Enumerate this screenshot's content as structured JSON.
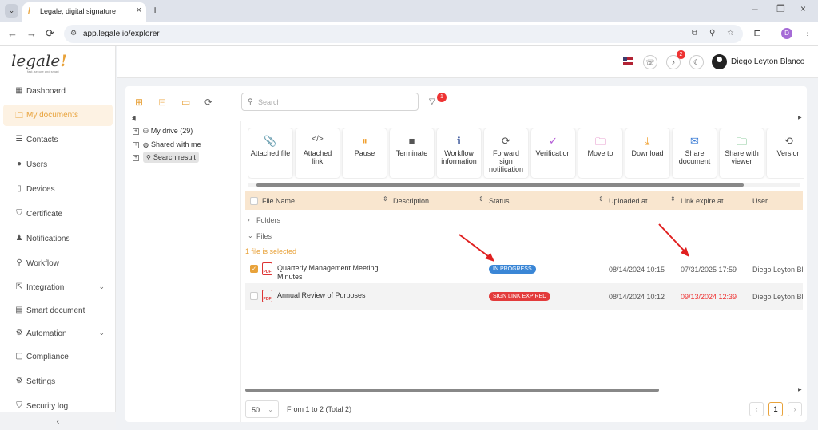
{
  "browser": {
    "tab_title": "Legale, digital signature",
    "url": "app.legale.io/explorer",
    "profile_initial": "D"
  },
  "logo": {
    "text": "legale",
    "mark": "!",
    "tagline": "fast, secure and smart"
  },
  "sidebar": {
    "items": [
      {
        "label": "Dashboard",
        "icon": "dashboard-icon",
        "glyph": "▦"
      },
      {
        "label": "My documents",
        "icon": "folder-icon",
        "glyph": "🗀"
      },
      {
        "label": "Contacts",
        "icon": "contacts-icon",
        "glyph": "☰"
      },
      {
        "label": "Users",
        "icon": "user-icon",
        "glyph": "●"
      },
      {
        "label": "Devices",
        "icon": "device-icon",
        "glyph": "▯"
      },
      {
        "label": "Certificate",
        "icon": "shield-icon",
        "glyph": "⛉"
      },
      {
        "label": "Notifications",
        "icon": "bell-icon",
        "glyph": "♟"
      },
      {
        "label": "Workflow",
        "icon": "workflow-icon",
        "glyph": "⚲"
      },
      {
        "label": "Integration",
        "icon": "integration-icon",
        "glyph": "⇱"
      },
      {
        "label": "Smart document",
        "icon": "smart-document-icon",
        "glyph": "▤"
      },
      {
        "label": "Automation",
        "icon": "automation-icon",
        "glyph": "⚙"
      },
      {
        "label": "Compliance",
        "icon": "compliance-icon",
        "glyph": "▢"
      },
      {
        "label": "Settings",
        "icon": "gear-icon",
        "glyph": "⚙"
      },
      {
        "label": "Security log",
        "icon": "security-log-icon",
        "glyph": "⛉"
      }
    ],
    "collapse": "‹"
  },
  "topbar": {
    "user_name": "Diego Leyton Blanco",
    "notification_count": "2"
  },
  "tree": {
    "items": [
      {
        "label": "My drive (29)"
      },
      {
        "label": "Shared with me"
      },
      {
        "label": "Search result"
      }
    ]
  },
  "search": {
    "placeholder": "Search",
    "filter_count": "1"
  },
  "actions": [
    {
      "label": "Attached file",
      "icon": "paperclip-icon",
      "glyph": "📎",
      "color": "#555555"
    },
    {
      "label": "Attached link",
      "icon": "code-icon",
      "glyph": "</>",
      "color": "#555555"
    },
    {
      "label": "Pause",
      "icon": "pause-icon",
      "glyph": "⏸",
      "color": "#f0a030"
    },
    {
      "label": "Terminate",
      "icon": "stop-icon",
      "glyph": "■",
      "color": "#555555"
    },
    {
      "label": "Workflow information",
      "icon": "info-icon",
      "glyph": "ℹ",
      "color": "#1a3a8a"
    },
    {
      "label": "Forward sign notification",
      "icon": "refresh-icon",
      "glyph": "⟳",
      "color": "#555555"
    },
    {
      "label": "Verification",
      "icon": "check-circle-icon",
      "glyph": "✓",
      "color": "#b35bd6"
    },
    {
      "label": "Move to",
      "icon": "move-folder-icon",
      "glyph": "🗀",
      "color": "#d64fa8"
    },
    {
      "label": "Download",
      "icon": "download-icon",
      "glyph": "⤓",
      "color": "#f0a030"
    },
    {
      "label": "Share document",
      "icon": "mail-icon",
      "glyph": "✉",
      "color": "#3a7bd5"
    },
    {
      "label": "Share with viewer",
      "icon": "share-folder-icon",
      "glyph": "🗀",
      "color": "#2e9e4a"
    },
    {
      "label": "Version",
      "icon": "version-icon",
      "glyph": "⟲",
      "color": "#555555"
    }
  ],
  "table": {
    "headers": [
      "File Name",
      "Description",
      "Status",
      "Uploaded at",
      "Link expire at",
      "User"
    ],
    "folders_label": "Folders",
    "files_label": "Files",
    "selected_text": "1 file is selected",
    "rows": [
      {
        "name": "Quarterly Management Meeting Minutes",
        "status": "IN PROGRESS",
        "status_color": "#3a86d6",
        "uploaded": "08/14/2024 10:15",
        "expire": "07/31/2025 17:59",
        "user": "Diego Leyton Bla",
        "selected": true
      },
      {
        "name": "Annual Review of Purposes",
        "status": "SIGN LINK EXPIRED",
        "status_color": "#e33b3b",
        "uploaded": "08/14/2024 10:12",
        "expire": "09/13/2024 12:39",
        "user": "Diego Leyton Bla",
        "selected": false
      }
    ]
  },
  "pager": {
    "size": "50",
    "text": "From 1 to 2 (Total 2)",
    "current_page": "1"
  }
}
